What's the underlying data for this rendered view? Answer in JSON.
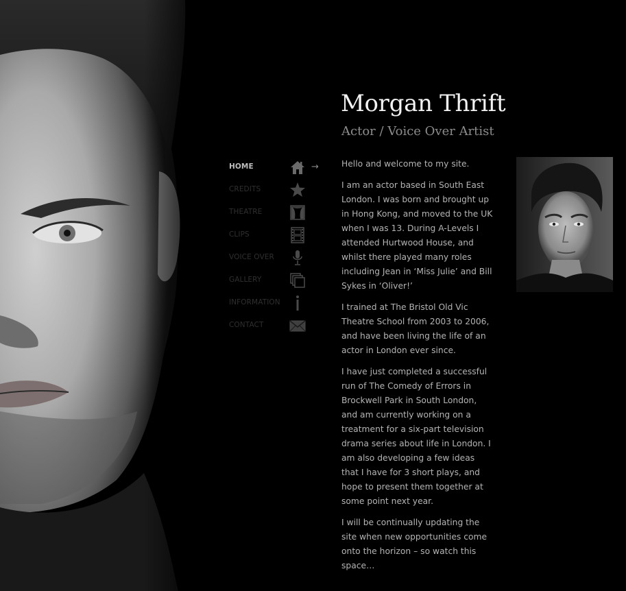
{
  "header": {
    "title": "Morgan Thrift",
    "subtitle": "Actor / Voice Over Artist"
  },
  "nav": {
    "items": [
      {
        "label": "HOME",
        "icon": "home-icon",
        "active": true
      },
      {
        "label": "CREDITS",
        "icon": "star-icon",
        "active": false
      },
      {
        "label": "THEATRE",
        "icon": "theatre-stage-icon",
        "active": false
      },
      {
        "label": "CLIPS",
        "icon": "film-strip-icon",
        "active": false
      },
      {
        "label": "VOICE OVER",
        "icon": "microphone-icon",
        "active": false
      },
      {
        "label": "GALLERY",
        "icon": "gallery-stack-icon",
        "active": false
      },
      {
        "label": "INFORMATION",
        "icon": "info-icon",
        "active": false
      },
      {
        "label": "CONTACT",
        "icon": "envelope-icon",
        "active": false
      }
    ],
    "active_arrow": "→"
  },
  "content": {
    "paragraphs": [
      "Hello and welcome to my site.",
      "I am an actor based in South East London. I was born and brought up in Hong Kong, and moved to the UK when I was 13. During A-Levels I attended Hurtwood House, and whilst there played many roles including Jean in ‘Miss Julie’ and Bill Sykes in ‘Oliver!’",
      "I trained at The Bristol Old Vic Theatre School from 2003 to 2006, and have been living the life of an actor in London ever since.",
      "I have just completed a successful run of The Comedy of Errors in Brockwell Park in South London, and am currently working on a treatment for a six-part television drama series about life in London. I am also developing a few ideas that I have for 3 short plays, and hope to present them together at some point next year.",
      "I will be continually updating the site when new opportunities come onto the horizon – so watch this space…"
    ]
  },
  "colors": {
    "background": "#000000",
    "title": "#f2f2f2",
    "subtitle": "#8c8c8c",
    "body_text": "#b4b4b4",
    "nav_active": "#bdbdbd",
    "nav_inactive": "#2f2f2f"
  }
}
